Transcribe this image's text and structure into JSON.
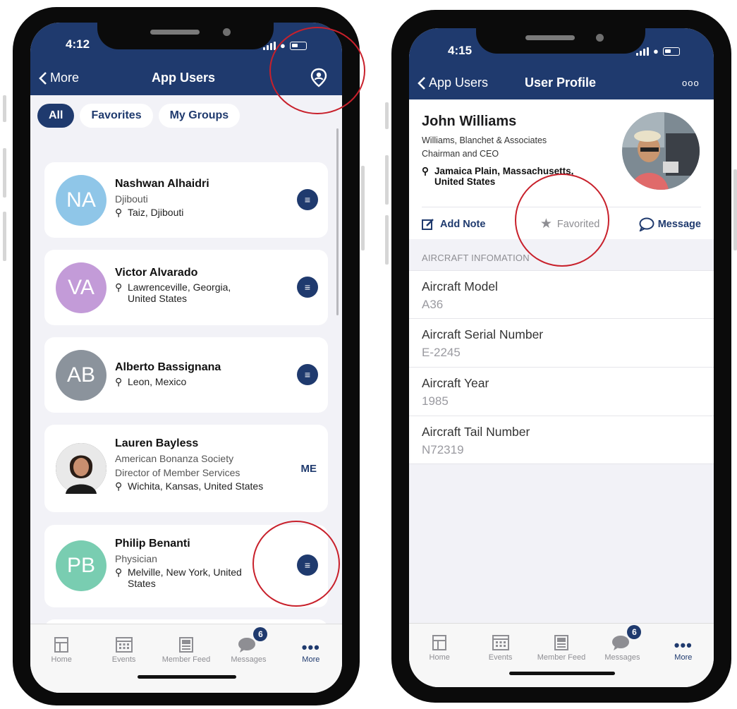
{
  "colors": {
    "navy": "#1f3a6e",
    "annotation_red": "#c8202b"
  },
  "left_phone": {
    "status": {
      "time": "4:12"
    },
    "nav": {
      "back": "More",
      "title": "App Users",
      "right_icon": "user-pin-icon"
    },
    "chips": [
      "All",
      "Favorites",
      "My Groups"
    ],
    "users": [
      {
        "initials": "NA",
        "avatar_color": "#8fc6e8",
        "name": "Nashwan Alhaidri",
        "sub": [
          "Djibouti"
        ],
        "location": "Taiz, Djibouti",
        "action": "message"
      },
      {
        "initials": "VA",
        "avatar_color": "#c39bd8",
        "name": "Victor Alvarado",
        "sub": [],
        "location": "Lawrenceville, Georgia, United States",
        "action": "message"
      },
      {
        "initials": "AB",
        "avatar_color": "#8b939c",
        "name": "Alberto Bassignana",
        "sub": [],
        "location": "Leon, Mexico",
        "action": "message"
      },
      {
        "initials": "",
        "avatar_color": "#3a3a3a",
        "name": "Lauren Bayless",
        "sub": [
          "American Bonanza Society",
          "Director of Member Services"
        ],
        "location": "Wichita, Kansas, United States",
        "action": "me",
        "action_label": "ME"
      },
      {
        "initials": "PB",
        "avatar_color": "#79cdb1",
        "name": "Philip Benanti",
        "sub": [
          "Physician"
        ],
        "location": "Melville, New York, United States",
        "action": "message"
      }
    ],
    "tabs": [
      {
        "label": "Home",
        "icon": "home-icon"
      },
      {
        "label": "Events",
        "icon": "calendar-icon"
      },
      {
        "label": "Member Feed",
        "icon": "feed-icon"
      },
      {
        "label": "Messages",
        "icon": "messages-icon",
        "badge": "6"
      },
      {
        "label": "More",
        "icon": "more-dots-icon",
        "active": true
      }
    ]
  },
  "right_phone": {
    "status": {
      "time": "4:15"
    },
    "nav": {
      "back": "App Users",
      "title": "User Profile",
      "more": "ooo"
    },
    "profile": {
      "name": "John Williams",
      "company": "Williams, Blanchet & Associates",
      "title": "Chairman and CEO",
      "location_line1": "Jamaica Plain, Massachusetts,",
      "location_line2": "United States"
    },
    "actions": {
      "add_note": "Add Note",
      "favorited": "Favorited",
      "message": "Message"
    },
    "section_header": "AIRCRAFT INFOMATION",
    "fields": [
      {
        "label": "Aircraft Model",
        "value": "A36"
      },
      {
        "label": "Aircraft Serial Number",
        "value": "E-2245"
      },
      {
        "label": "Aircraft Year",
        "value": "1985"
      },
      {
        "label": "Aircraft Tail Number",
        "value": "N72319"
      }
    ],
    "tabs": [
      {
        "label": "Home",
        "icon": "home-icon"
      },
      {
        "label": "Events",
        "icon": "calendar-icon"
      },
      {
        "label": "Member Feed",
        "icon": "feed-icon"
      },
      {
        "label": "Messages",
        "icon": "messages-icon",
        "badge": "6"
      },
      {
        "label": "More",
        "icon": "more-dots-icon",
        "active": true
      }
    ]
  }
}
